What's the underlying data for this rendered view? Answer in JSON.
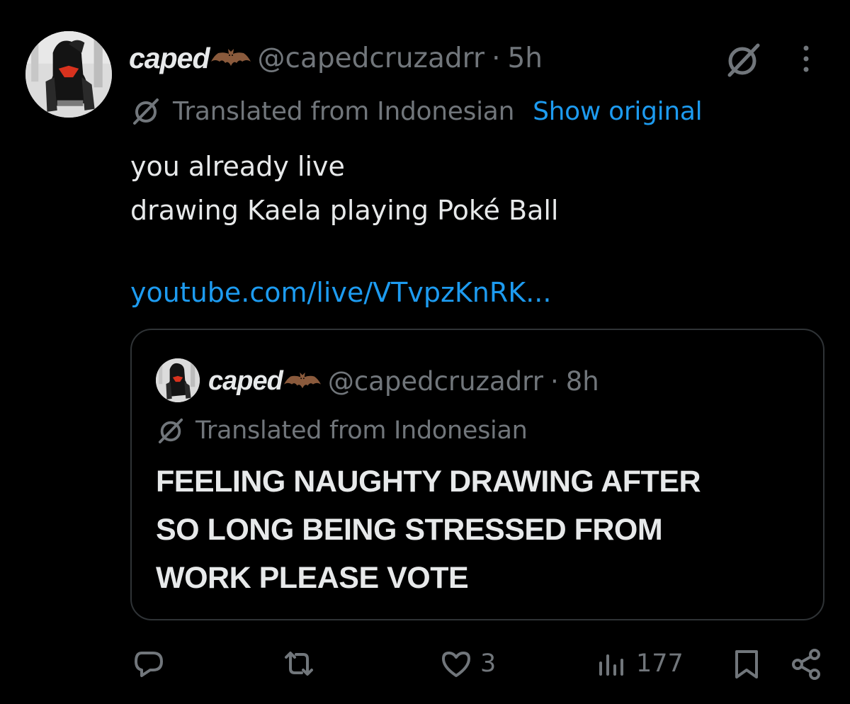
{
  "post": {
    "display_name": "caped",
    "handle": "@capedcruzadrr",
    "separator": "·",
    "time": "5h",
    "translation_label": "Translated from Indonesian",
    "show_original_label": "Show original",
    "text_line1": "you already live",
    "text_line2": "drawing Kaela playing Poké Ball",
    "link": "youtube.com/live/VTvpzKnRK..."
  },
  "quote": {
    "display_name": "caped",
    "handle": "@capedcruzadrr",
    "separator": "·",
    "time": "8h",
    "translation_label": "Translated from Indonesian",
    "text": "FEELING NAUGHTY DRAWING AFTER\nSO LONG BEING STRESSED FROM\nWORK PLEASE VOTE"
  },
  "actions": {
    "reply_count": "",
    "repost_count": "",
    "like_count": "3",
    "views_count": "177"
  },
  "colors": {
    "background": "#000000",
    "text": "#e7e9ea",
    "muted": "#71767b",
    "link": "#1d9bf0",
    "border": "#2f3336"
  },
  "icons": [
    "avatar",
    "bat-emoji-icon",
    "grok-icon",
    "more-icon",
    "translate-icon",
    "reply-icon",
    "repost-icon",
    "like-icon",
    "views-icon",
    "bookmark-icon",
    "share-icon"
  ]
}
